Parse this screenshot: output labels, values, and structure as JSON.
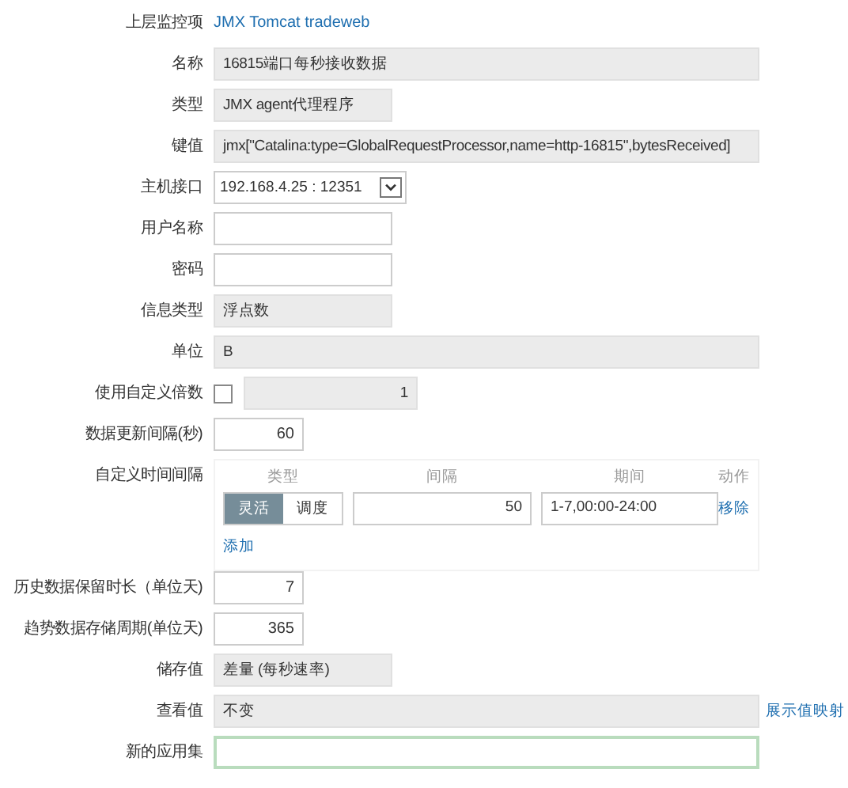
{
  "form": {
    "rows": [
      {
        "kind": "link",
        "label": "上层监控项",
        "value": "JMX Tomcat tradeweb"
      },
      {
        "kind": "longreadonly",
        "label": "名称",
        "value": "16815端口每秒接收数据"
      },
      {
        "kind": "readonly",
        "label": "类型",
        "value": "JMX agent代理程序"
      },
      {
        "kind": "longreadonly",
        "label": "键值",
        "value": "jmx[\"Catalina:type=GlobalRequestProcessor,name=http-16815\",bytesReceived]"
      },
      {
        "kind": "select",
        "label": "主机接口",
        "value": "192.168.4.25 : 12351"
      },
      {
        "kind": "input",
        "label": "用户名称"
      },
      {
        "kind": "input",
        "label": "密码"
      },
      {
        "kind": "readonly",
        "label": "信息类型",
        "value": "浮点数"
      },
      {
        "kind": "longreadonly",
        "label": "单位",
        "value": "B"
      },
      {
        "kind": "multiplier",
        "label": "使用自定义倍数",
        "checked": false,
        "value": "1"
      },
      {
        "kind": "number",
        "label": "数据更新间隔(秒)",
        "value": "60"
      },
      {
        "kind": "intervals",
        "label": "自定义时间间隔",
        "columns": [
          "类型",
          "间隔",
          "期间",
          "动作"
        ],
        "entries": [
          {
            "types": [
              {
                "label": "灵活",
                "selected": true
              },
              {
                "label": "调度",
                "selected": false
              }
            ],
            "interval": "50",
            "period": "1-7,00:00-24:00",
            "action": "移除"
          }
        ],
        "add": "添加"
      },
      {
        "kind": "number",
        "label": "历史数据保留时长（单位天)",
        "value": "7"
      },
      {
        "kind": "number",
        "label": "趋势数据存储周期(单位天)",
        "value": "365"
      },
      {
        "kind": "readonly",
        "label": "储存值",
        "value": "差量 (每秒速率)"
      },
      {
        "kind": "longreadonly",
        "label": "查看值",
        "value": "不变",
        "link": "展示值映射"
      },
      {
        "kind": "longinput",
        "label": "新的应用集",
        "focused": true
      }
    ]
  }
}
